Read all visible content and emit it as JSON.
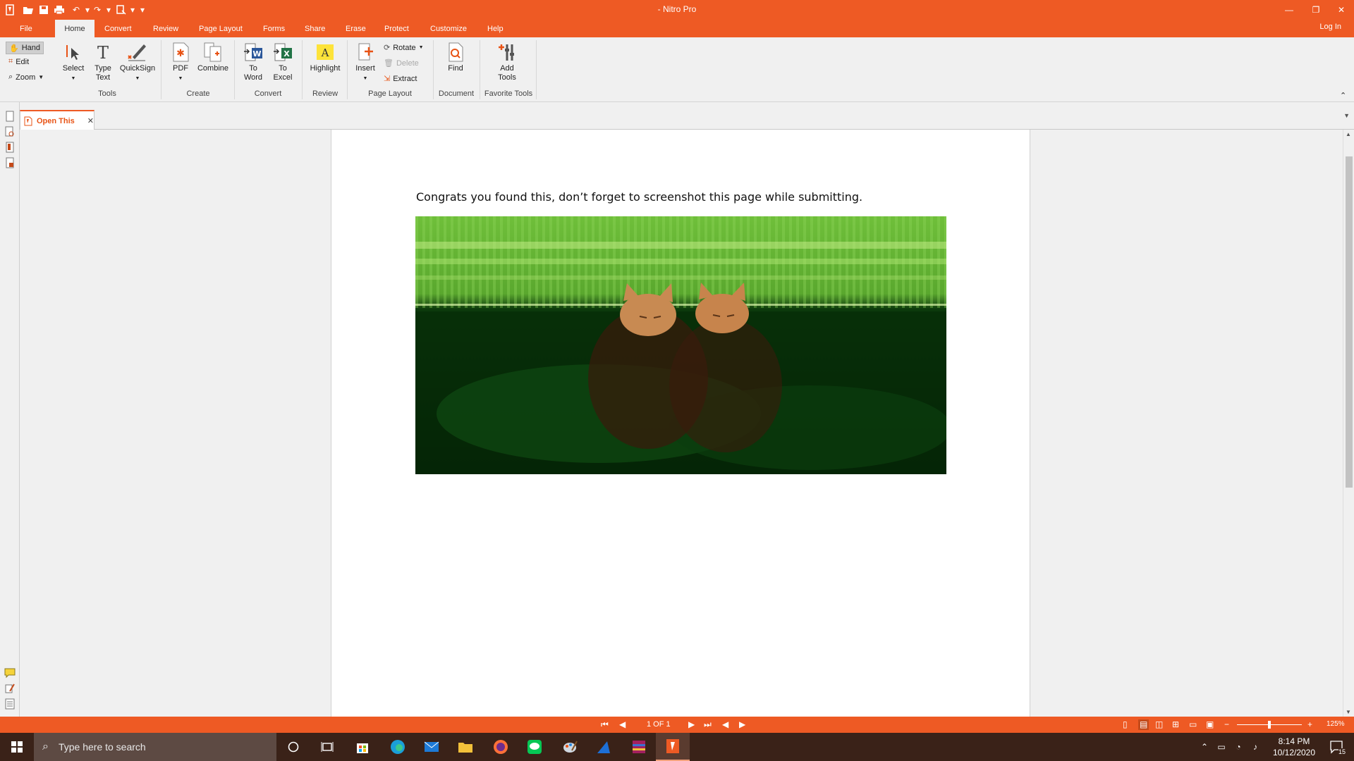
{
  "window": {
    "title": "- Nitro Pro",
    "login_label": "Log In"
  },
  "menu_tabs": [
    "File",
    "Home",
    "Convert",
    "Review",
    "Page Layout",
    "Forms",
    "Share",
    "Erase",
    "Protect",
    "Customize",
    "Help"
  ],
  "ribbon": {
    "mode_buttons": {
      "hand": "Hand",
      "edit": "Edit",
      "zoom": "Zoom"
    },
    "tools": {
      "select": "Select",
      "type_text_1": "Type",
      "type_text_2": "Text",
      "quicksign": "QuickSign"
    },
    "create": {
      "pdf": "PDF",
      "combine": "Combine"
    },
    "convert": {
      "to_word_1": "To",
      "to_word_2": "Word",
      "to_excel_1": "To",
      "to_excel_2": "Excel"
    },
    "review": {
      "highlight": "Highlight"
    },
    "page_layout": {
      "insert": "Insert",
      "rotate": "Rotate",
      "delete": "Delete",
      "extract": "Extract"
    },
    "document": {
      "find": "Find"
    },
    "favorite": {
      "add_tools_1": "Add",
      "add_tools_2": "Tools"
    },
    "groups": {
      "tools": "Tools",
      "create": "Create",
      "convert": "Convert",
      "review": "Review",
      "page_layout": "Page Layout",
      "document": "Document",
      "favorite_tools": "Favorite Tools"
    }
  },
  "document_tab": {
    "label": "Open This"
  },
  "document": {
    "text": "Congrats you found this, don’t forget to screenshot this page while submitting."
  },
  "status": {
    "page_info": "1 OF 1",
    "zoom": "125%"
  },
  "taskbar": {
    "search_placeholder": "Type here to search",
    "time": "8:14 PM",
    "date": "10/12/2020",
    "notifications": "15"
  },
  "colors": {
    "accent": "#ee5a24",
    "taskbar": "#3a2218"
  }
}
